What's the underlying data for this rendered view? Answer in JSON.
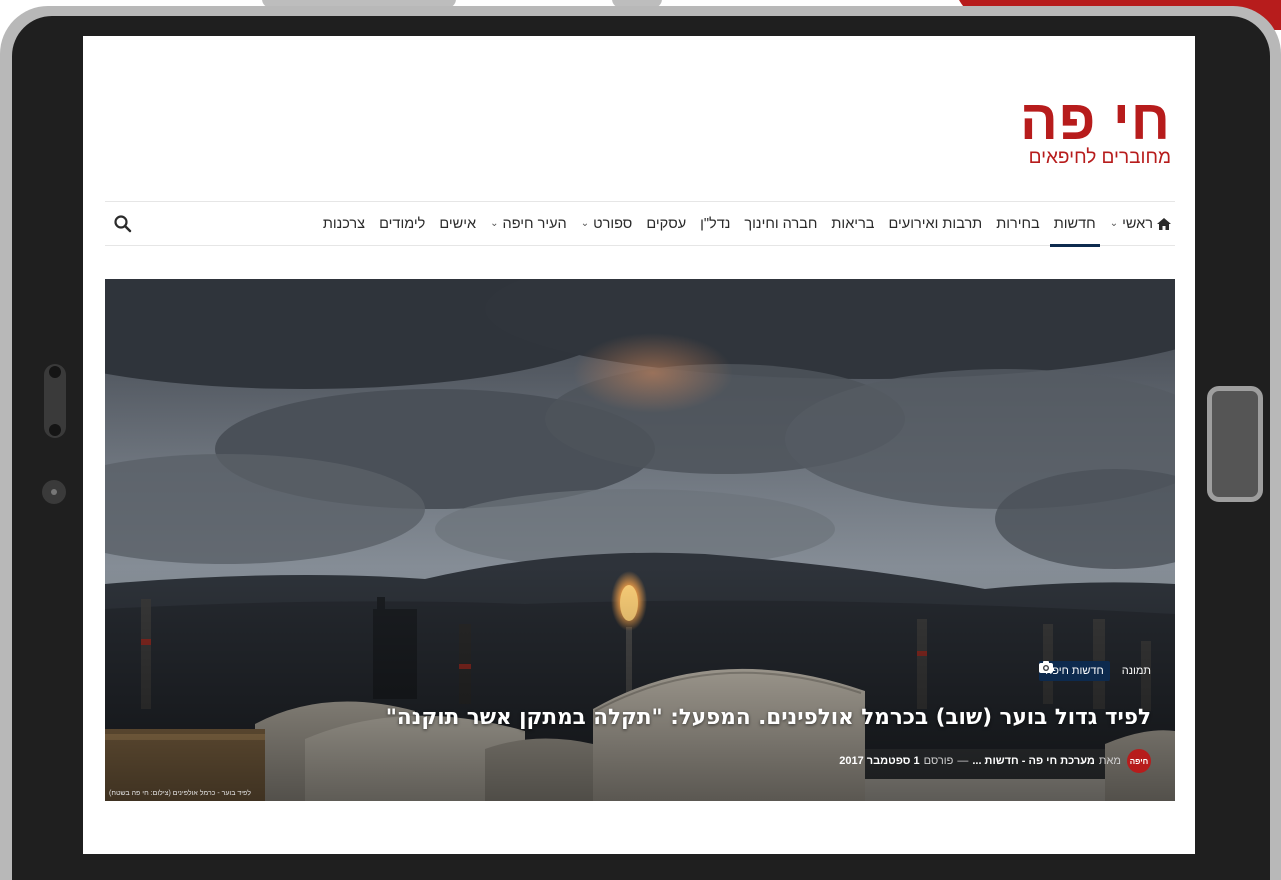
{
  "site": {
    "logo_title": "חי פה",
    "logo_subtitle": "מחוברים לחיפאים",
    "brand_color": "#b71c1c",
    "accent_color": "#0d2a4e"
  },
  "nav": {
    "items": [
      {
        "label": "ראשי",
        "icon": "home-icon",
        "has_dropdown": true
      },
      {
        "label": "חדשות",
        "active": true
      },
      {
        "label": "בחירות"
      },
      {
        "label": "תרבות ואירועים"
      },
      {
        "label": "בריאות"
      },
      {
        "label": "חברה וחינוך"
      },
      {
        "label": "נדל\"ן"
      },
      {
        "label": "עסקים"
      },
      {
        "label": "ספורט",
        "has_dropdown": true
      },
      {
        "label": "העיר חיפה",
        "has_dropdown": true
      },
      {
        "label": "אישים"
      },
      {
        "label": "לימודים"
      },
      {
        "label": "צרכנות"
      }
    ],
    "search_icon": "search-icon"
  },
  "article": {
    "media_type_label": "תמונה",
    "media_icon": "camera-icon",
    "category": "חדשות חיפה",
    "title": "לפיד גדול בוער (שוב) בכרמל אולפינים. המפעל: \"תקלה במתקן אשר תוקנה\"",
    "avatar_text": "חיפה",
    "by_label": "מאת",
    "author": "מערכת חי פה - חדשות ...",
    "separator": "—",
    "published_label": "פורסם",
    "date": "1 ספטמבר 2017",
    "image_caption": "לפיד בוער - כרמל אולפינים (צילום: חי פה בשטח)"
  }
}
